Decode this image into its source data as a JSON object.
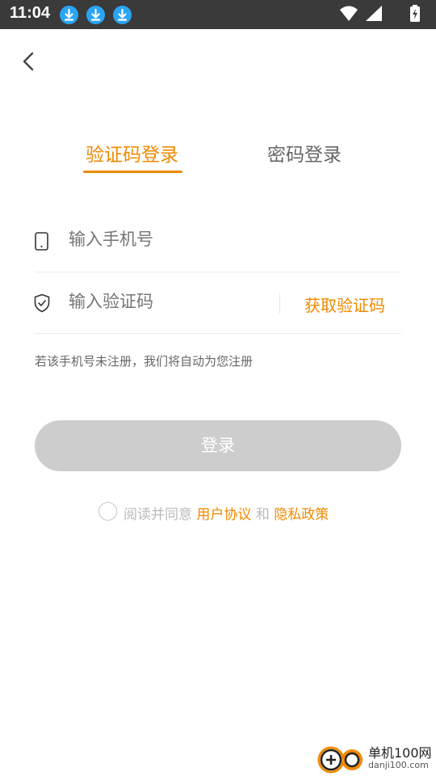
{
  "status_bar": {
    "time": "11:04",
    "notification_icons": [
      "download-icon",
      "download-icon",
      "download-icon"
    ],
    "right_icons": [
      "wifi-icon",
      "cell-signal-icon",
      "battery-charging-icon"
    ]
  },
  "nav": {
    "back_icon": "chevron-left-icon"
  },
  "tabs": [
    {
      "label": "验证码登录",
      "active": true
    },
    {
      "label": "密码登录",
      "active": false
    }
  ],
  "form": {
    "phone_placeholder": "输入手机号",
    "code_placeholder": "输入验证码",
    "get_code_label": "获取验证码",
    "hint": "若该手机号未注册，我们将自动为您注册"
  },
  "login_button": "登录",
  "agreement": {
    "prefix": "阅读并同意",
    "user_agreement": "用户协议",
    "and": "和",
    "privacy_policy": "隐私政策",
    "checked": false
  },
  "watermark": {
    "title": "单机100网",
    "url": "danji100.com"
  },
  "colors": {
    "accent": "#f08a00",
    "button_disabled": "#cdcdcd",
    "status_bar": "#3a3a3a",
    "download_badge": "#2aa5f4"
  }
}
